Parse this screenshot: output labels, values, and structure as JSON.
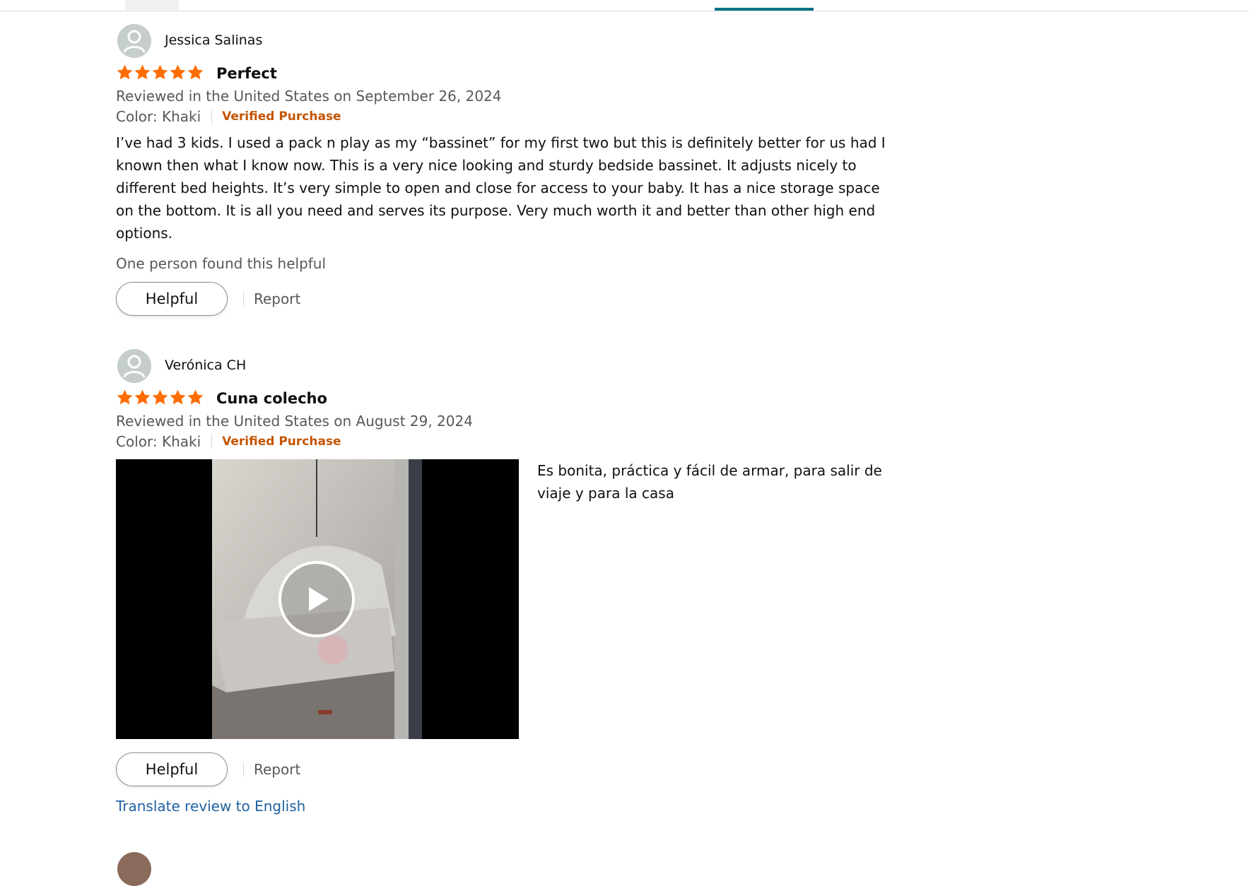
{
  "colors": {
    "star": "#ff6d00",
    "verified": "#c45500",
    "link": "#2162a1",
    "secondary_text": "#565959",
    "tab_active": "#007185"
  },
  "icons": {
    "avatar": "user-silhouette-icon",
    "star": "star-filled-icon",
    "play": "play-icon"
  },
  "reviews": [
    {
      "reviewer": "Jessica Salinas",
      "rating": 5,
      "rating_max": 5,
      "title": "Perfect",
      "date": "Reviewed in the United States on September 26, 2024",
      "variant": "Color: Khaki",
      "verified": "Verified Purchase",
      "body": "I’ve had 3 kids. I used a pack n play as my “bassinet” for my first two but this is definitely better for us had I known then what I know now. This is a very nice looking and sturdy bedside bassinet. It adjusts nicely to different bed heights. It’s very simple to open and close for access to your baby. It has a nice storage space on the bottom. It is all you need and serves its purpose. Very much worth it and better than other high end options.",
      "helpful_count": "One person found this helpful",
      "helpful_label": "Helpful",
      "report_label": "Report"
    },
    {
      "reviewer": "Verónica CH",
      "rating": 5,
      "rating_max": 5,
      "title": "Cuna colecho",
      "date": "Reviewed in the United States on August 29, 2024",
      "variant": "Color: Khaki",
      "verified": "Verified Purchase",
      "body": "Es bonita, práctica y fácil de armar, para salir de viaje y para la casa",
      "helpful_label": "Helpful",
      "report_label": "Report",
      "translate_label": "Translate review to English"
    }
  ]
}
